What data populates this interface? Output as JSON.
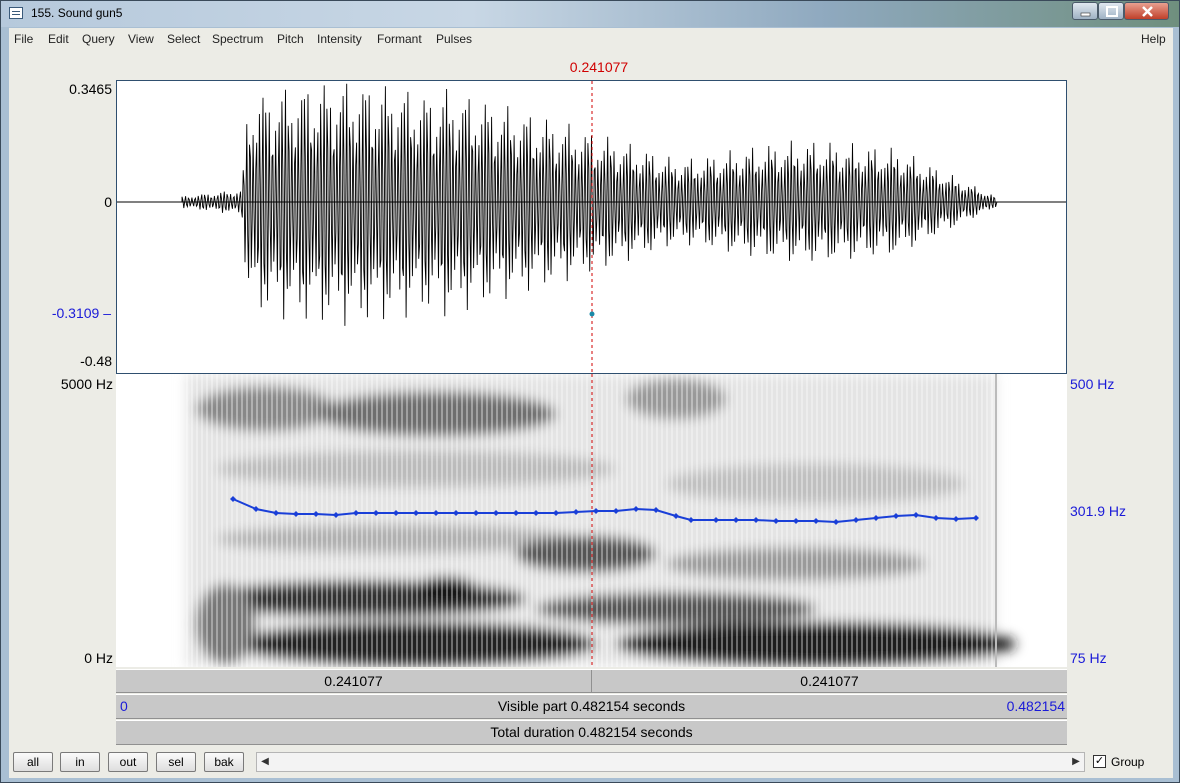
{
  "window": {
    "title": "155. Sound gun5"
  },
  "menu": [
    "File",
    "Edit",
    "Query",
    "View",
    "Select",
    "Spectrum",
    "Pitch",
    "Intensity",
    "Formant",
    "Pulses",
    "Help"
  ],
  "cursor": {
    "time_label": "0.241077",
    "color": "#d00000"
  },
  "waveform": {
    "y_max": "0.3465",
    "y_zero": "0",
    "y_cursor": "-0.3109",
    "y_min": "-0.48"
  },
  "spectrogram": {
    "freq_top": "5000 Hz",
    "freq_bottom": "0 Hz",
    "pitch_top": "500 Hz",
    "pitch_cursor": "301.9 Hz",
    "pitch_bottom": "75 Hz",
    "pitch_color": "#1a3fd8"
  },
  "selection_bar": {
    "left": "0.241077",
    "right": "0.241077"
  },
  "visible_bar": {
    "start": "0",
    "text": "Visible part 0.482154 seconds",
    "end": "0.482154"
  },
  "total_bar": {
    "text": "Total duration 0.482154 seconds"
  },
  "buttons": {
    "all": "all",
    "in": "in",
    "out": "out",
    "sel": "sel",
    "bak": "bak"
  },
  "group": {
    "label": "Group",
    "checked": true,
    "mark": "✓"
  }
}
